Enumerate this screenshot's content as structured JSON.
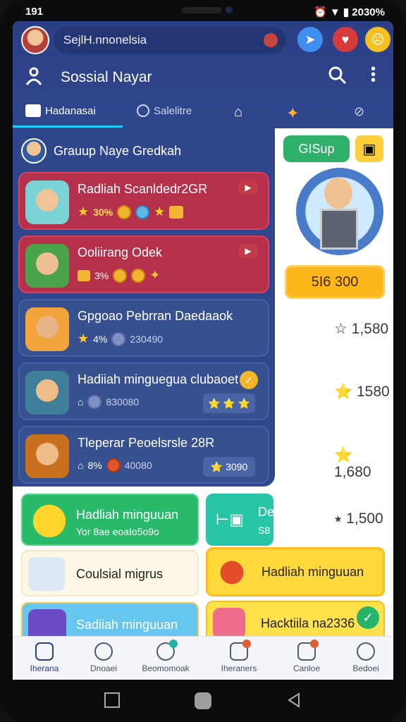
{
  "status": {
    "time": "191",
    "right": "⏰ ▼ ▮ 2030%"
  },
  "header": {
    "search_text": "SejlH.nnonelsia",
    "title": "Sossial Nayar",
    "tabs": [
      {
        "label": "Hadanasai"
      },
      {
        "label": "Salelitre"
      }
    ]
  },
  "group": {
    "title": "Grauup Naye Gredkah"
  },
  "cards": [
    {
      "title": "Radliah Scanldedr2GR",
      "sub": "30%",
      "style": "red"
    },
    {
      "title": "Ooliirang Odek",
      "sub": "3%",
      "style": "red"
    },
    {
      "title": "Gpgoao Pebrran Daedaaok",
      "sub": "4%",
      "value": "230490",
      "style": "blue"
    },
    {
      "title": "Hadiiah minguegua clubaoet",
      "value": "830080",
      "style": "blue"
    },
    {
      "title": "Tleperar Peoelsrsle 28R",
      "sub": "8%",
      "value": "40080",
      "style": "blue"
    }
  ],
  "card_pills": [
    "▶",
    "▶",
    "⭐ ⭐ ⭐",
    "⭐ 3090"
  ],
  "right": {
    "button_label": "GISup",
    "gold_label": "5I6 300"
  },
  "scores": [
    "☆ 1,580",
    "⭐ 1580",
    "⭐ 1,680",
    "⭑ 1,500"
  ],
  "tiles": [
    {
      "title": "Hadliah minguuan",
      "sub": "Yor 8ae eoaIo5o9o"
    },
    {
      "title": "De",
      "sub": "S8"
    },
    {
      "title": "Coulsial migrus"
    },
    {
      "title": "Hadliah minguuan"
    },
    {
      "title": "Sadiiah minguuan"
    },
    {
      "title": "Hacktiila na2336"
    }
  ],
  "nav": [
    {
      "label": "Iherana"
    },
    {
      "label": "Dnoaei"
    },
    {
      "label": "Beomomoak"
    },
    {
      "label": "Iheraners"
    },
    {
      "label": "Canloe"
    },
    {
      "label": "Bedoei"
    }
  ],
  "colors": {
    "header": "#2c3f86",
    "red": "#b5304a",
    "blue": "#37508f",
    "gold": "#fdb61c",
    "green": "#2fb169"
  }
}
